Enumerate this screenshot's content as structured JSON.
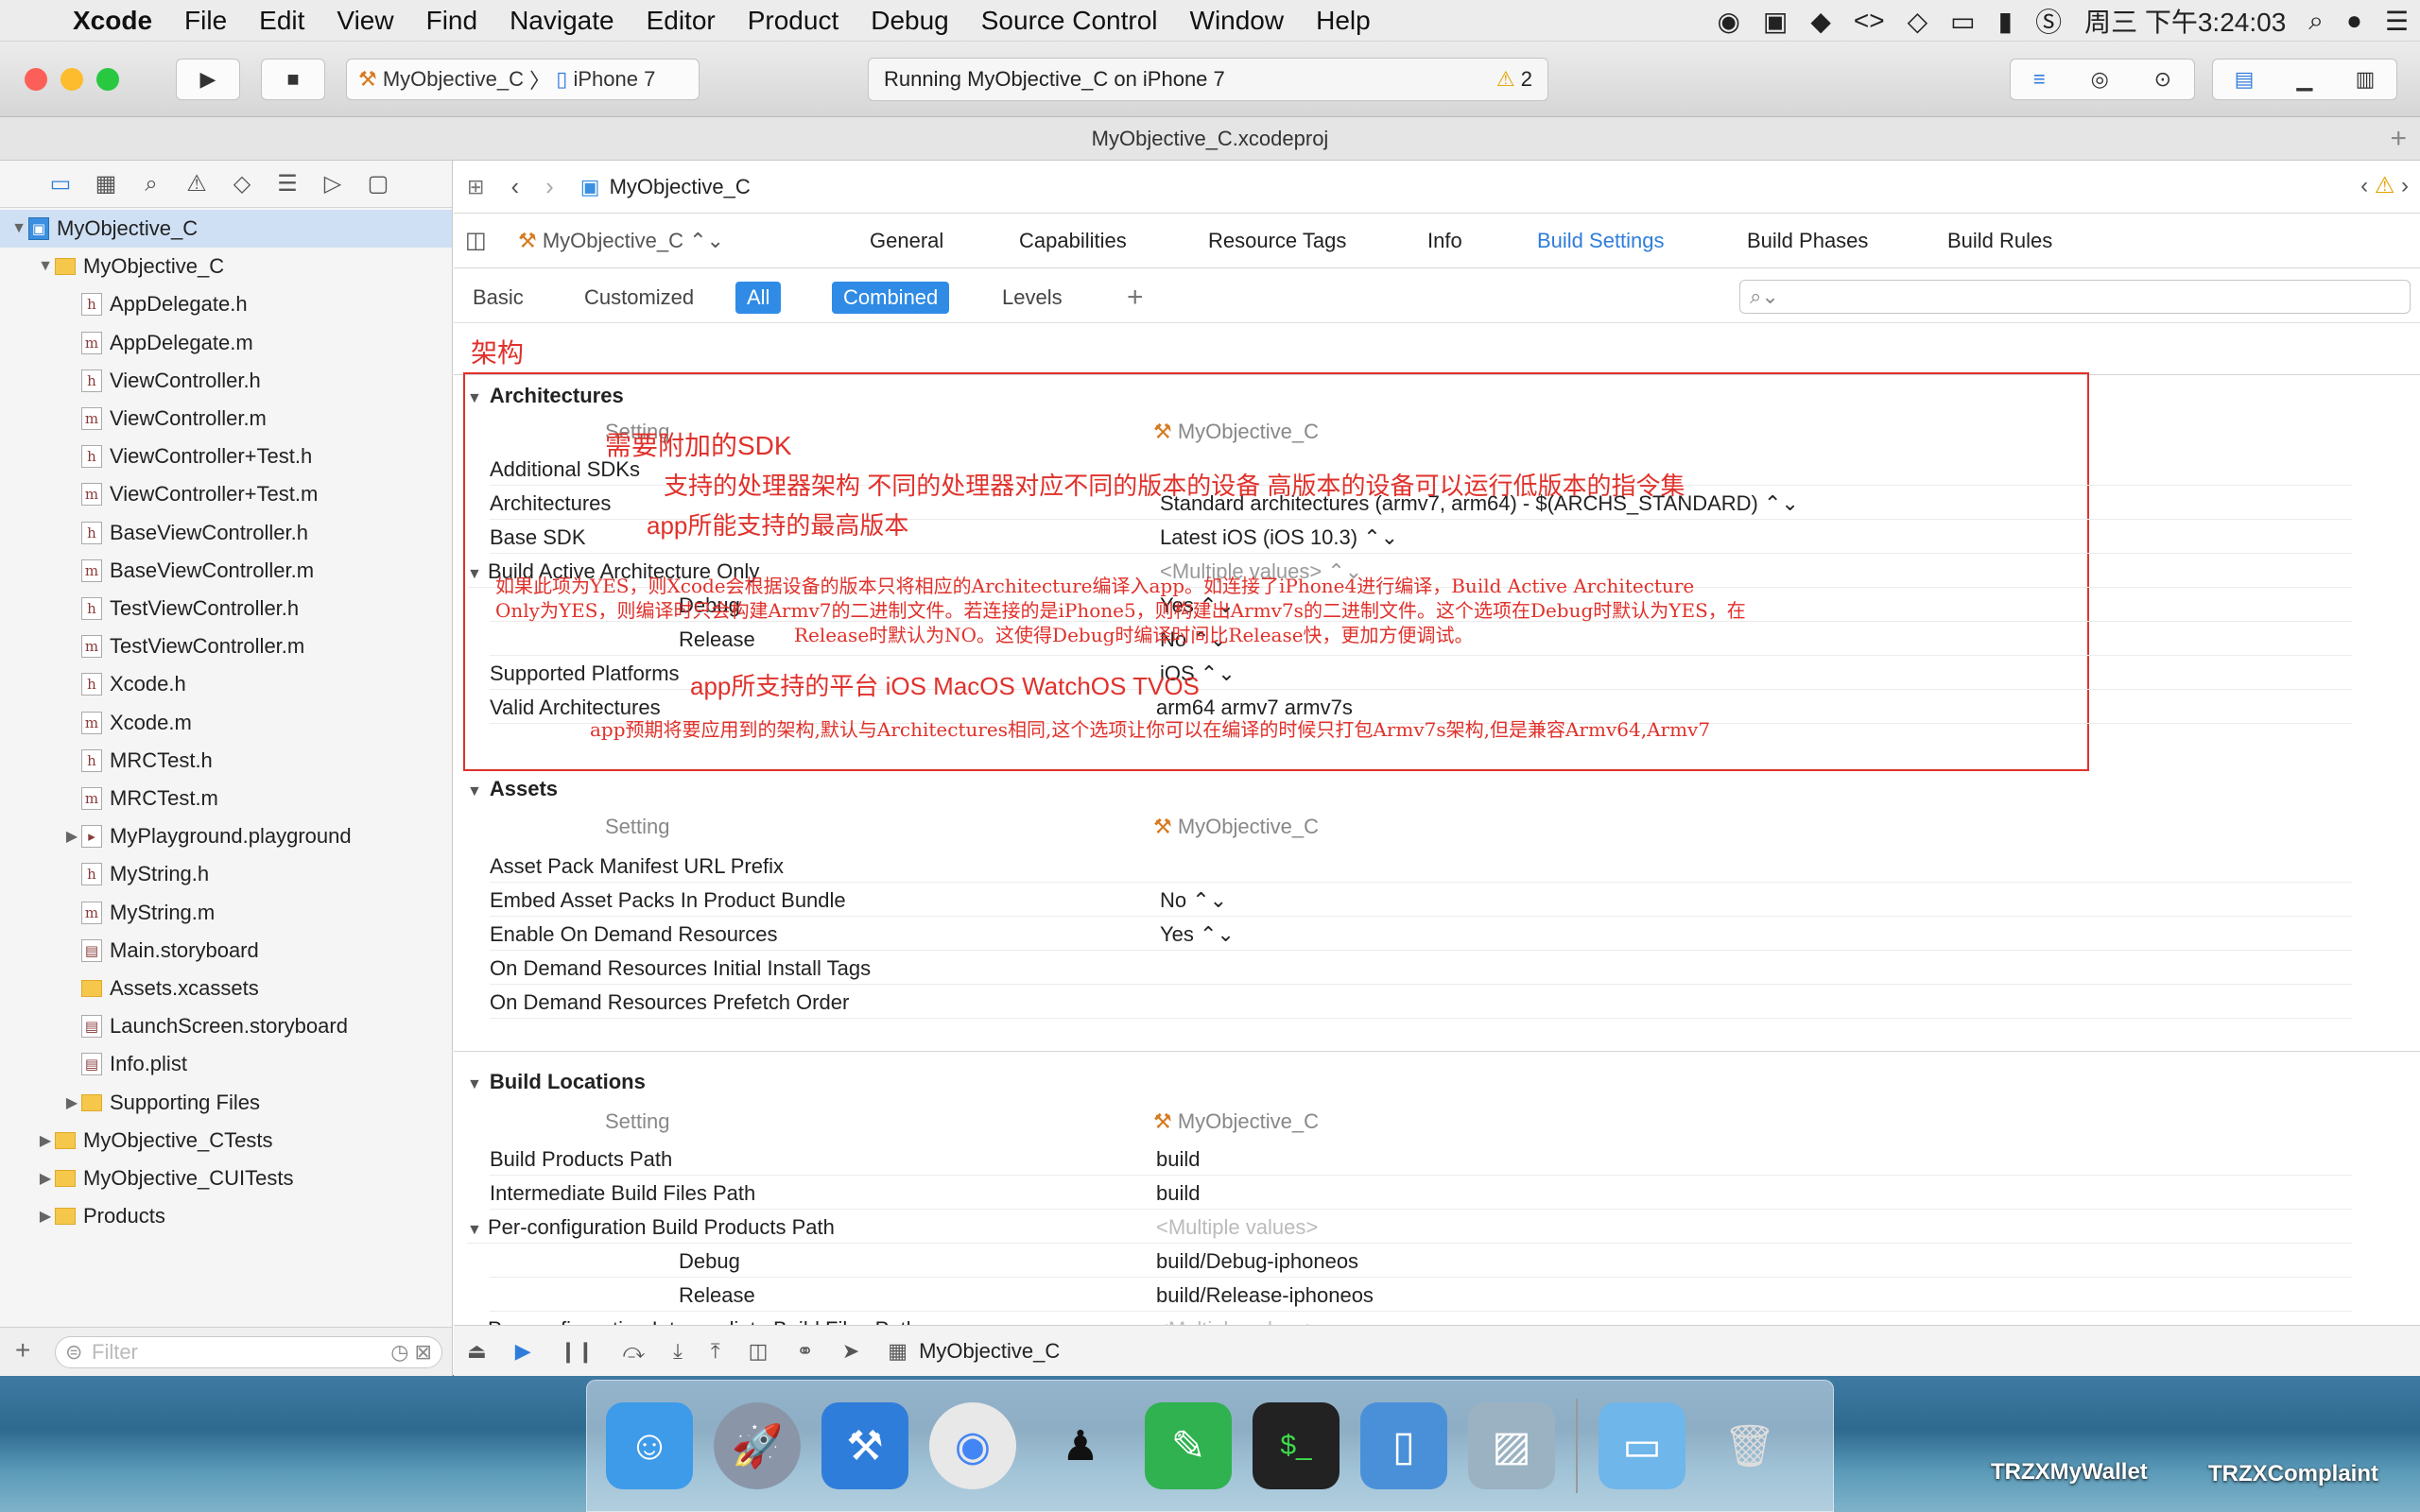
{
  "menubar": {
    "items": [
      "Xcode",
      "File",
      "Edit",
      "View",
      "Find",
      "Navigate",
      "Editor",
      "Product",
      "Debug",
      "Source Control",
      "Window",
      "Help"
    ],
    "clock": "周三 下午3:24:03"
  },
  "toolbar": {
    "scheme": "MyObjective_C",
    "device": "iPhone 7",
    "activity": "Running MyObjective_C on iPhone 7",
    "warnings": "2"
  },
  "window_title": "MyObjective_C.xcodeproj",
  "navigator": {
    "items": [
      {
        "label": "MyObjective_C",
        "indent": 0,
        "type": "proj",
        "disc": "▼",
        "selected": true
      },
      {
        "label": "MyObjective_C",
        "indent": 1,
        "type": "folder",
        "disc": "▼"
      },
      {
        "label": "AppDelegate.h",
        "indent": 2,
        "type": "h"
      },
      {
        "label": "AppDelegate.m",
        "indent": 2,
        "type": "m"
      },
      {
        "label": "ViewController.h",
        "indent": 2,
        "type": "h"
      },
      {
        "label": "ViewController.m",
        "indent": 2,
        "type": "m"
      },
      {
        "label": "ViewController+Test.h",
        "indent": 2,
        "type": "h"
      },
      {
        "label": "ViewController+Test.m",
        "indent": 2,
        "type": "m"
      },
      {
        "label": "BaseViewController.h",
        "indent": 2,
        "type": "h"
      },
      {
        "label": "BaseViewController.m",
        "indent": 2,
        "type": "m"
      },
      {
        "label": "TestViewController.h",
        "indent": 2,
        "type": "h"
      },
      {
        "label": "TestViewController.m",
        "indent": 2,
        "type": "m"
      },
      {
        "label": "Xcode.h",
        "indent": 2,
        "type": "h"
      },
      {
        "label": "Xcode.m",
        "indent": 2,
        "type": "m"
      },
      {
        "label": "MRCTest.h",
        "indent": 2,
        "type": "h"
      },
      {
        "label": "MRCTest.m",
        "indent": 2,
        "type": "m"
      },
      {
        "label": "MyPlayground.playground",
        "indent": 2,
        "type": "play",
        "disc": "▶"
      },
      {
        "label": "MyString.h",
        "indent": 2,
        "type": "h"
      },
      {
        "label": "MyString.m",
        "indent": 2,
        "type": "m"
      },
      {
        "label": "Main.storyboard",
        "indent": 2,
        "type": "sb"
      },
      {
        "label": "Assets.xcassets",
        "indent": 2,
        "type": "folder"
      },
      {
        "label": "LaunchScreen.storyboard",
        "indent": 2,
        "type": "sb"
      },
      {
        "label": "Info.plist",
        "indent": 2,
        "type": "plist"
      },
      {
        "label": "Supporting Files",
        "indent": 2,
        "type": "folder",
        "disc": "▶"
      },
      {
        "label": "MyObjective_CTests",
        "indent": 1,
        "type": "folder",
        "disc": "▶"
      },
      {
        "label": "MyObjective_CUITests",
        "indent": 1,
        "type": "folder",
        "disc": "▶"
      },
      {
        "label": "Products",
        "indent": 1,
        "type": "folder",
        "disc": "▶"
      }
    ],
    "filter_placeholder": "Filter"
  },
  "jumpbar": {
    "file": "MyObjective_C"
  },
  "tabs": {
    "target": "MyObjective_C",
    "items": [
      "General",
      "Capabilities",
      "Resource Tags",
      "Info",
      "Build Settings",
      "Build Phases",
      "Build Rules"
    ],
    "active": "Build Settings"
  },
  "filterbar": {
    "basic": "Basic",
    "customized": "Customized",
    "all": "All",
    "combined": "Combined",
    "levels": "Levels"
  },
  "sections": {
    "arch": {
      "title": "Architectures",
      "setting_hdr": "Setting",
      "target_hdr": "MyObjective_C",
      "rows": {
        "additional_sdks": "Additional SDKs",
        "architectures": "Architectures",
        "architectures_val": "Standard architectures (armv7, arm64) - $(ARCHS_STANDARD) ⌃⌄",
        "base_sdk": "Base SDK",
        "base_sdk_val": "Latest iOS (iOS 10.3) ⌃⌄",
        "baao": "Build Active Architecture Only",
        "baao_val": "<Multiple values> ⌃⌄",
        "debug": "Debug",
        "debug_val": "Yes ⌃⌄",
        "release": "Release",
        "release_val": "No ⌃⌄",
        "platforms": "Supported Platforms",
        "platforms_val": "iOS ⌃⌄",
        "valid": "Valid Architectures",
        "valid_val": "arm64 armv7 armv7s"
      }
    },
    "assets": {
      "title": "Assets",
      "setting_hdr": "Setting",
      "target_hdr": "MyObjective_C",
      "rows": {
        "r1": "Asset Pack Manifest URL Prefix",
        "r2": "Embed Asset Packs In Product Bundle",
        "r2v": "No ⌃⌄",
        "r3": "Enable On Demand Resources",
        "r3v": "Yes ⌃⌄",
        "r4": "On Demand Resources Initial Install Tags",
        "r5": "On Demand Resources Prefetch Order"
      }
    },
    "locations": {
      "title": "Build Locations",
      "setting_hdr": "Setting",
      "target_hdr": "MyObjective_C",
      "rows": {
        "r1": "Build Products Path",
        "r1v": "build",
        "r2": "Intermediate Build Files Path",
        "r2v": "build",
        "r3": "Per-configuration Build Products Path",
        "r3v": "<Multiple values>",
        "r4": "Debug",
        "r4v": "build/Debug-iphoneos",
        "r5": "Release",
        "r5v": "build/Release-iphoneos",
        "r6": "Per-configuration Intermediate Build Files Path",
        "r6v": "<Multiple values>"
      }
    }
  },
  "annotations": {
    "jiagou": "架构",
    "sdk": "需要附加的SDK",
    "arch": "支持的处理器架构 不同的处理器对应不同的版本的设备 高版本的设备可以运行低版本的指令集",
    "base": "app所能支持的最高版本",
    "baao1": "如果此项为YES，则Xcode会根据设备的版本只将相应的Architecture编译入app。如连接了iPhone4进行编译，Build Active Architecture",
    "baao2": "Only为YES，则编译时只会构建Armv7的二进制文件。若连接的是iPhone5，则构建出Armv7s的二进制文件。这个选项在Debug时默认为YES，在",
    "baao3": "Release时默认为NO。这使得Debug时编译时间比Release快，更加方便调试。",
    "platforms": "app所支持的平台 iOS MacOS WatchOS TVOS",
    "valid": "app预期将要应用到的架构,默认与Architectures相同,这个选项让你可以在编译的时候只打包Armv7s架构,但是兼容Armv64,Armv7"
  },
  "debugbar": {
    "target": "MyObjective_C"
  },
  "desktop": {
    "label1": "TRZXMyWallet",
    "label2": "TRZXComplaint"
  }
}
